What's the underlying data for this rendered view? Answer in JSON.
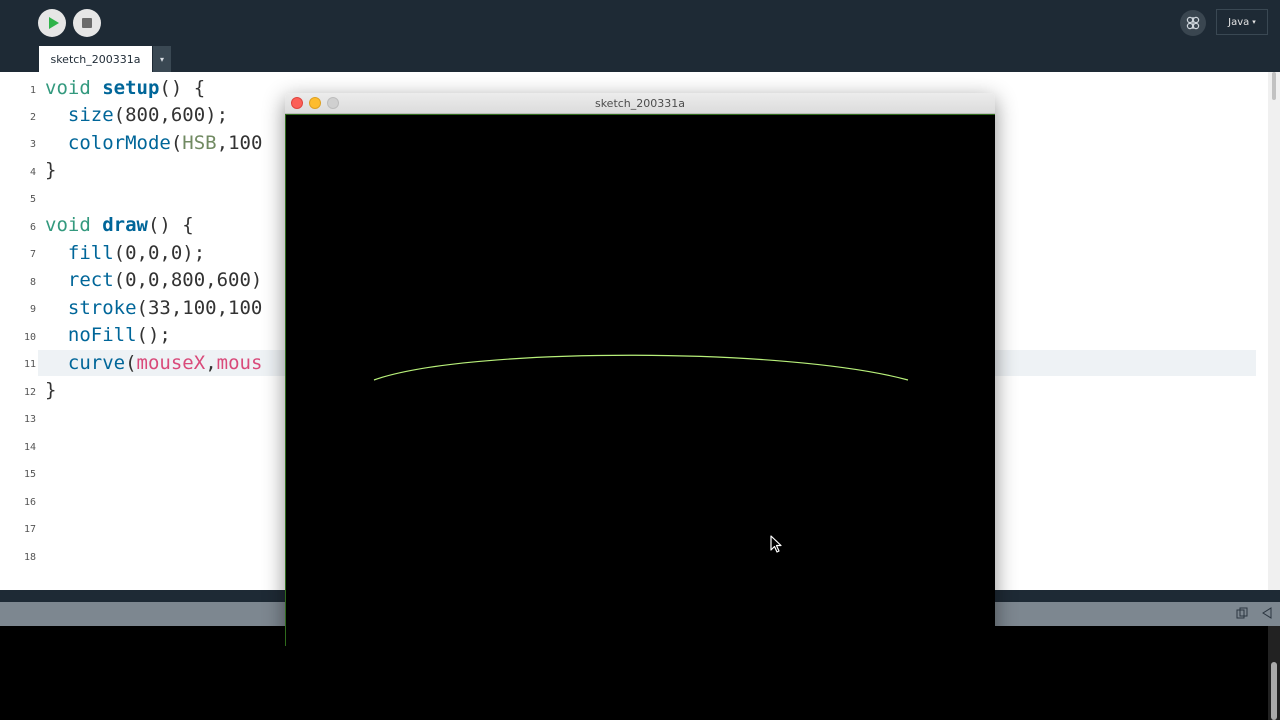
{
  "toolbar": {
    "run_icon": "play-icon",
    "stop_icon": "stop-icon",
    "debug_icon": "debug-butterfly-icon",
    "mode_label": "Java",
    "mode_caret": "▾"
  },
  "tabs": {
    "active_label": "sketch_200331a",
    "menu_glyph": "▾"
  },
  "editor": {
    "line_numbers": [
      "1",
      "2",
      "3",
      "4",
      "5",
      "6",
      "7",
      "8",
      "9",
      "10",
      "11",
      "12",
      "13",
      "14",
      "15",
      "16",
      "17",
      "18"
    ],
    "code": {
      "l1_type": "void",
      "l1_name": "setup",
      "l1_rest": "() {",
      "l2_fn": "size",
      "l2_rest": "(800,600);",
      "l3_fn": "colorMode",
      "l3_open": "(",
      "l3_const": "HSB",
      "l3_rest": ",100",
      "l4": "}",
      "l6_type": "void",
      "l6_name": "draw",
      "l6_rest": "() {",
      "l7_fn": "fill",
      "l7_rest": "(0,0,0);",
      "l8_fn": "rect",
      "l8_rest": "(0,0,800,600)",
      "l9_fn": "stroke",
      "l9_rest": "(33,100,100",
      "l10_fn": "noFill",
      "l10_rest": "();",
      "l11_fn": "curve",
      "l11_open": "(",
      "l11_var1": "mouseX",
      "l11_sep": ",",
      "l11_var2": "mous",
      "l12": "}"
    },
    "highlighted_line": 11
  },
  "sketch_window": {
    "title": "sketch_200331a",
    "canvas_background": "#000000",
    "curve_color": "#b8f07a"
  },
  "console": {
    "copy_icon": "copy-icon",
    "collapse_icon": "collapse-icon"
  },
  "colors": {
    "toolbar_bg": "#1e2a35",
    "editor_bg": "#ffffff",
    "run_green": "#2fb34a"
  }
}
